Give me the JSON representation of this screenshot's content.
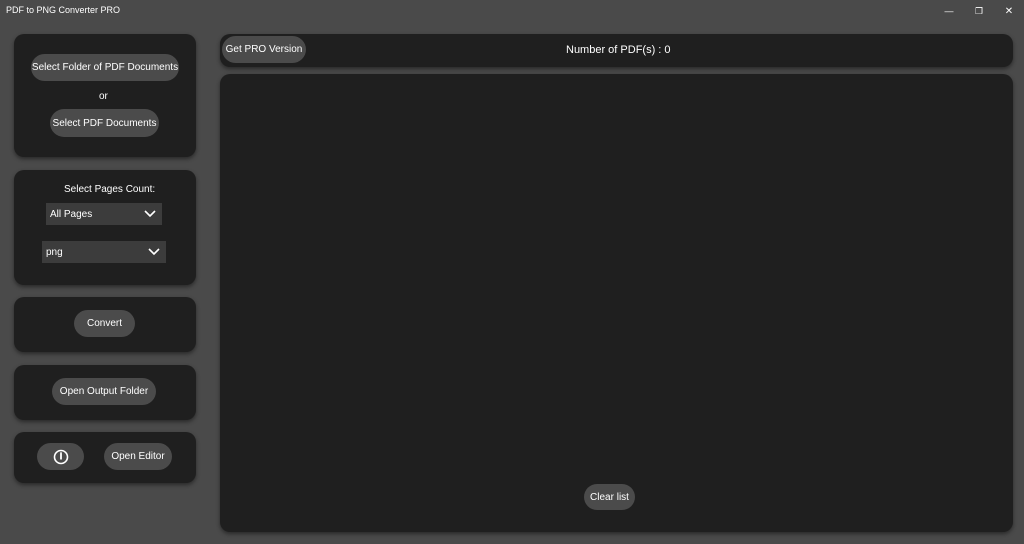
{
  "window": {
    "title": "PDF to PNG Converter PRO",
    "minimize_glyph": "—",
    "restore_glyph": "❐",
    "close_glyph": "✕"
  },
  "source_panel": {
    "select_folder_label": "Select Folder of PDF Documents",
    "or_label": "or",
    "select_docs_label": "Select PDF Documents"
  },
  "options_panel": {
    "pages_count_label": "Select Pages Count:",
    "pages_selected": "All Pages",
    "format_selected": "png"
  },
  "actions": {
    "convert_label": "Convert",
    "open_output_label": "Open Output Folder",
    "info_icon": "info-icon",
    "open_editor_label": "Open Editor"
  },
  "header": {
    "pro_label": "Get PRO Version",
    "pdf_count_text": "Number of PDF(s) : 0"
  },
  "list": {
    "clear_label": "Clear list"
  }
}
